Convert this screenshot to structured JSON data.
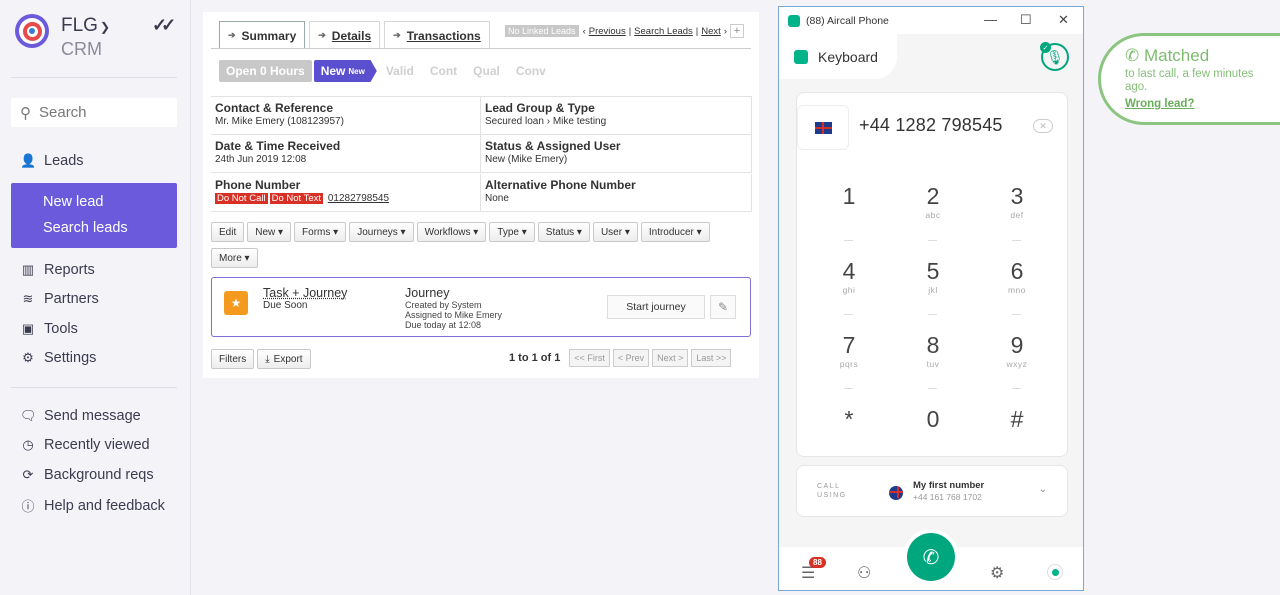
{
  "sidebar": {
    "brand": "FLG",
    "brand_sub": "CRM",
    "search_placeholder": "Search",
    "leads_label": "Leads",
    "new_lead": "New lead",
    "search_leads": "Search leads",
    "items": [
      {
        "label": "Reports",
        "icon": "bar-chart-icon"
      },
      {
        "label": "Partners",
        "icon": "handshake-icon"
      },
      {
        "label": "Tools",
        "icon": "toolbox-icon"
      },
      {
        "label": "Settings",
        "icon": "gear-icon"
      }
    ],
    "bottom_items": [
      {
        "label": "Send message",
        "icon": "chat-icon"
      },
      {
        "label": "Recently viewed",
        "icon": "clock-icon"
      },
      {
        "label": "Background reqs",
        "icon": "refresh-icon"
      },
      {
        "label": "Help and feedback",
        "icon": "help-icon"
      }
    ]
  },
  "lead": {
    "tabs": [
      "Summary",
      "Details",
      "Transactions"
    ],
    "toplinks": {
      "badge": "No Linked Leads",
      "previous": "Previous",
      "search": "Search Leads",
      "next": "Next"
    },
    "stages": {
      "open": "Open 0 Hours",
      "new": "New",
      "new_small": "New",
      "valid": "Valid",
      "cont": "Cont",
      "qual": "Qual",
      "conv": "Conv"
    },
    "fields": {
      "contact_label": "Contact & Reference",
      "contact_value": "Mr. Mike Emery (108123957)",
      "group_label": "Lead Group & Type",
      "group_value": "Secured loan › Mike testing",
      "date_label": "Date & Time Received",
      "date_value": "24th Jun 2019 12:08",
      "status_label": "Status & Assigned User",
      "status_value": "New (Mike Emery)",
      "phone_label": "Phone Number",
      "phone_tag1": "Do Not Call",
      "phone_tag2": "Do Not Text",
      "phone_value": "01282798545",
      "alt_label": "Alternative Phone Number",
      "alt_value": "None"
    },
    "buttons": [
      "Edit",
      "New ▾",
      "Forms ▾",
      "Journeys ▾",
      "Workflows ▾",
      "Type ▾",
      "Status ▾",
      "User ▾",
      "Introducer ▾"
    ],
    "more_button": "More ▾",
    "journey": {
      "task_title": "Task + Journey",
      "task_due": "Due Soon",
      "heading": "Journey",
      "created": "Created by System",
      "assigned": "Assigned to Mike Emery",
      "due": "Due today at 12:08",
      "start": "Start journey"
    },
    "footer": {
      "filters": "Filters",
      "export": "Export",
      "count": "1 to 1 of 1",
      "first": "<< First",
      "prev": "< Prev",
      "next": "Next >",
      "last": "Last >>"
    }
  },
  "aircall": {
    "window_title": "(88) Aircall Phone",
    "tab": "Keyboard",
    "dial_number": "+44 1282 798545",
    "keys": [
      {
        "d": "1",
        "l": ""
      },
      {
        "d": "2",
        "l": "abc"
      },
      {
        "d": "3",
        "l": "def"
      },
      {
        "d": "4",
        "l": "ghi"
      },
      {
        "d": "5",
        "l": "jkl"
      },
      {
        "d": "6",
        "l": "mno"
      },
      {
        "d": "7",
        "l": "pqrs"
      },
      {
        "d": "8",
        "l": "tuv"
      },
      {
        "d": "9",
        "l": "wxyz"
      },
      {
        "d": "*",
        "l": ""
      },
      {
        "d": "0",
        "l": ""
      },
      {
        "d": "#",
        "l": ""
      }
    ],
    "call_using_label": "CALL USING",
    "number_name": "My first number",
    "number_value": "+44 161 768 1702",
    "notification_count": "88",
    "accent": "#00a67e"
  },
  "matched": {
    "title": "Matched",
    "subtitle": "to last call, a few minutes ago.",
    "link": "Wrong lead?"
  }
}
